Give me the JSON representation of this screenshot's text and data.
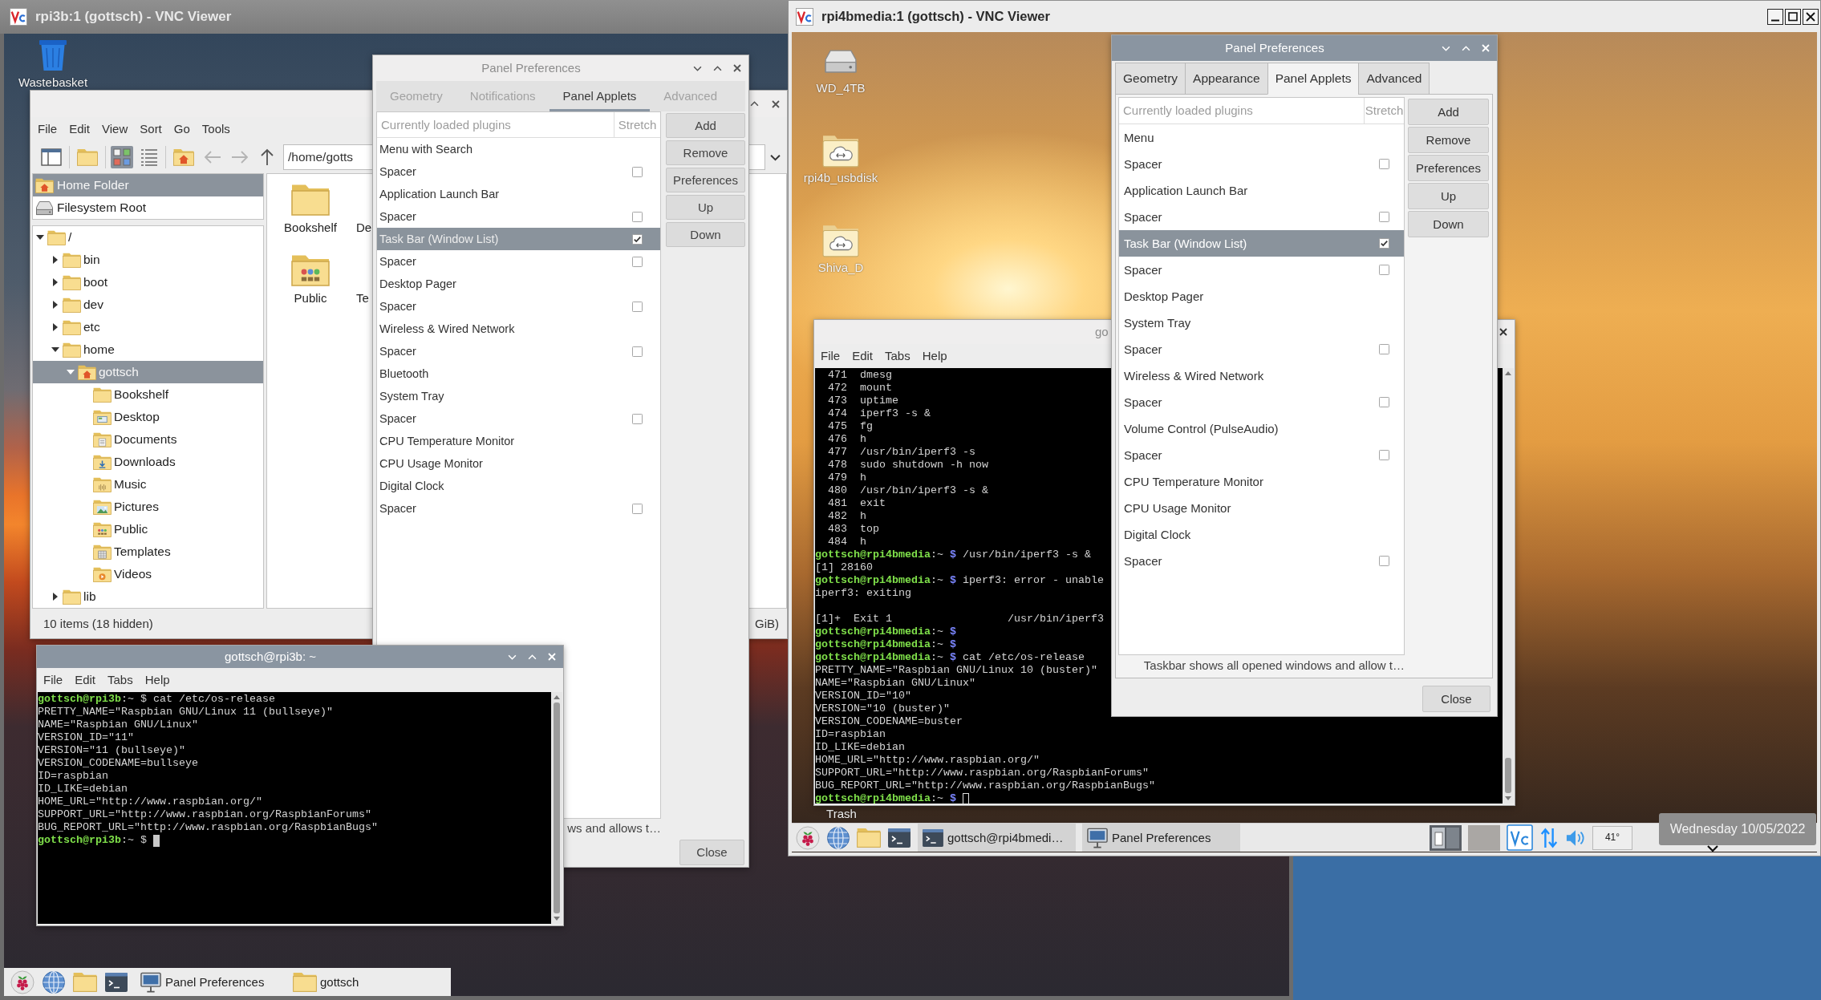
{
  "left_viewer": {
    "title": "rpi3b:1 (gottsch) - VNC Viewer",
    "active": false,
    "desktop_icons": [
      {
        "label": "Wastebasket",
        "kind": "trash"
      }
    ],
    "file_manager": {
      "active": false,
      "menu": [
        "File",
        "Edit",
        "View",
        "Sort",
        "Go",
        "Tools"
      ],
      "toolbar": [
        {
          "kind": "sidebar"
        },
        {
          "kind": "new_folder"
        },
        {
          "kind": "icon_view",
          "selected": true
        },
        {
          "kind": "list_view",
          "selected": false
        },
        {
          "kind": "home"
        },
        {
          "kind": "back",
          "disabled": true
        },
        {
          "kind": "forward",
          "disabled": true
        },
        {
          "kind": "up",
          "disabled": false
        }
      ],
      "path": "/home/gotts",
      "places": [
        {
          "label": "Home Folder",
          "kind": "home",
          "selected": true
        },
        {
          "label": "Filesystem Root",
          "kind": "drive",
          "selected": false
        }
      ],
      "tree": [
        {
          "label": "/",
          "kind": "folder",
          "expanded": true,
          "selected": false,
          "children": [
            {
              "label": "bin",
              "kind": "folder",
              "expanded": false,
              "selected": false
            },
            {
              "label": "boot",
              "kind": "folder",
              "expanded": false,
              "selected": false
            },
            {
              "label": "dev",
              "kind": "folder",
              "expanded": false,
              "selected": false
            },
            {
              "label": "etc",
              "kind": "folder",
              "expanded": false,
              "selected": false
            },
            {
              "label": "home",
              "kind": "folder",
              "expanded": true,
              "selected": false,
              "children": [
                {
                  "label": "gottsch",
                  "kind": "home",
                  "expanded": true,
                  "selected": true,
                  "children": [
                    {
                      "label": "Bookshelf",
                      "kind": "folder",
                      "selected": false
                    },
                    {
                      "label": "Desktop",
                      "kind": "desktop",
                      "selected": false
                    },
                    {
                      "label": "Documents",
                      "kind": "documents",
                      "selected": false
                    },
                    {
                      "label": "Downloads",
                      "kind": "downloads",
                      "selected": false
                    },
                    {
                      "label": "Music",
                      "kind": "music",
                      "selected": false
                    },
                    {
                      "label": "Pictures",
                      "kind": "pictures",
                      "selected": false
                    },
                    {
                      "label": "Public",
                      "kind": "public",
                      "selected": false
                    },
                    {
                      "label": "Templates",
                      "kind": "templates",
                      "selected": false
                    },
                    {
                      "label": "Videos",
                      "kind": "videos",
                      "selected": false
                    }
                  ]
                }
              ]
            },
            {
              "label": "lib",
              "kind": "folder",
              "expanded": false,
              "selected": false
            }
          ]
        }
      ],
      "items": [
        {
          "label": "Bookshelf",
          "kind": "folder"
        },
        {
          "label": "De"
        },
        {
          "label": "Public",
          "kind": "public"
        },
        {
          "label": "Te"
        }
      ],
      "status": "10 items (18 hidden)",
      "free_space": "GiB)"
    },
    "panel_preferences": {
      "title": "Panel Preferences",
      "active": false,
      "tabs": [
        {
          "label": "Geometry",
          "selected": false
        },
        {
          "label": "Notifications",
          "selected": false
        },
        {
          "label": "Panel Applets",
          "selected": true
        },
        {
          "label": "Advanced",
          "selected": false
        }
      ],
      "columns": [
        "Currently loaded plugins",
        "Stretch"
      ],
      "plugins": [
        {
          "label": "Menu with Search",
          "selected": false
        },
        {
          "label": "Spacer",
          "checked": false,
          "selected": false
        },
        {
          "label": "Application Launch Bar",
          "selected": false
        },
        {
          "label": "Spacer",
          "checked": false,
          "selected": false
        },
        {
          "label": "Task Bar (Window List)",
          "checked": true,
          "selected": true
        },
        {
          "label": "Spacer",
          "checked": false,
          "selected": false
        },
        {
          "label": "Desktop Pager",
          "selected": false
        },
        {
          "label": "Spacer",
          "checked": false,
          "selected": false
        },
        {
          "label": "Wireless & Wired Network",
          "selected": false
        },
        {
          "label": "Spacer",
          "checked": false,
          "selected": false
        },
        {
          "label": "Bluetooth",
          "selected": false
        },
        {
          "label": "System Tray",
          "selected": false
        },
        {
          "label": "Spacer",
          "checked": false,
          "selected": false
        },
        {
          "label": "CPU Temperature Monitor",
          "selected": false
        },
        {
          "label": "CPU Usage Monitor",
          "selected": false
        },
        {
          "label": "Digital Clock",
          "selected": false
        },
        {
          "label": "Spacer",
          "checked": false,
          "selected": false
        }
      ],
      "description": "ws and allows t…",
      "buttons": [
        "Add",
        "Remove",
        "Preferences",
        "Up",
        "Down"
      ],
      "close": "Close"
    },
    "terminal": {
      "title": "gottsch@rpi3b: ~",
      "active": true,
      "menu": [
        "File",
        "Edit",
        "Tabs",
        "Help"
      ],
      "lines": [
        {
          "kind": "prompt",
          "host": "gottsch@rpi3b",
          "path": ":~ $",
          "command": "cat /etc/os-release"
        },
        {
          "kind": "output",
          "text": "PRETTY_NAME=\"Raspbian GNU/Linux 11 (bullseye)\""
        },
        {
          "kind": "output",
          "text": "NAME=\"Raspbian GNU/Linux\""
        },
        {
          "kind": "output",
          "text": "VERSION_ID=\"11\""
        },
        {
          "kind": "output",
          "text": "VERSION=\"11 (bullseye)\""
        },
        {
          "kind": "output",
          "text": "VERSION_CODENAME=bullseye"
        },
        {
          "kind": "output",
          "text": "ID=raspbian"
        },
        {
          "kind": "output",
          "text": "ID_LIKE=debian"
        },
        {
          "kind": "output",
          "text": "HOME_URL=\"http://www.raspbian.org/\""
        },
        {
          "kind": "output",
          "text": "SUPPORT_URL=\"http://www.raspbian.org/RaspbianForums\""
        },
        {
          "kind": "output",
          "text": "BUG_REPORT_URL=\"http://www.raspbian.org/RaspbianBugs\""
        },
        {
          "kind": "prompt",
          "host": "gottsch@rpi3b",
          "path": ":~ $"
        }
      ]
    },
    "taskbar": {
      "launchers": [
        {
          "kind": "raspberry"
        },
        {
          "kind": "browser"
        },
        {
          "kind": "files"
        },
        {
          "kind": "terminal"
        }
      ],
      "windows": [
        {
          "label": "Panel Preferences",
          "kind": "settings"
        },
        {
          "label": "gottsch",
          "kind": "folder"
        }
      ]
    }
  },
  "right_viewer": {
    "title": "rpi4bmedia:1 (gottsch) - VNC Viewer",
    "active": true,
    "desktop_icons": [
      {
        "label": "WD_4TB",
        "kind": "drive"
      },
      {
        "label": "rpi4b_usbdisk",
        "kind": "network"
      },
      {
        "label": "Shiva_D",
        "kind": "network"
      }
    ],
    "trash_label": "Trash",
    "terminal": {
      "title": "go",
      "active": false,
      "menu": [
        "File",
        "Edit",
        "Tabs",
        "Help"
      ],
      "lines": [
        {
          "kind": "output",
          "text": "  471  dmesg"
        },
        {
          "kind": "output",
          "text": "  472  mount"
        },
        {
          "kind": "output",
          "text": "  473  uptime"
        },
        {
          "kind": "output",
          "text": "  474  iperf3 -s &"
        },
        {
          "kind": "output",
          "text": "  475  fg"
        },
        {
          "kind": "output",
          "text": "  476  h"
        },
        {
          "kind": "output",
          "text": "  477  /usr/bin/iperf3 -s"
        },
        {
          "kind": "output",
          "text": "  478  sudo shutdown -h now"
        },
        {
          "kind": "output",
          "text": "  479  h"
        },
        {
          "kind": "output",
          "text": "  480  /usr/bin/iperf3 -s &"
        },
        {
          "kind": "output",
          "text": "  481  exit"
        },
        {
          "kind": "output",
          "text": "  482  h"
        },
        {
          "kind": "output",
          "text": "  483  top"
        },
        {
          "kind": "output",
          "text": "  484  h"
        },
        {
          "kind": "prompt",
          "host": "gottsch@rpi4bmedia",
          "path": ":~",
          "sigil": "$",
          "command": "/usr/bin/iperf3 -s &"
        },
        {
          "kind": "output",
          "text": "[1] 28160"
        },
        {
          "kind": "prompt",
          "host": "gottsch@rpi4bmedia",
          "path": ":~",
          "sigil": "$",
          "command": "iperf3: error - unable"
        },
        {
          "kind": "output",
          "text": "iperf3: exiting"
        },
        {
          "kind": "blank"
        },
        {
          "kind": "output",
          "text": "[1]+  Exit 1                  /usr/bin/iperf3"
        },
        {
          "kind": "prompt",
          "host": "gottsch@rpi4bmedia",
          "path": ":~",
          "sigil": "$"
        },
        {
          "kind": "prompt",
          "host": "gottsch@rpi4bmedia",
          "path": ":~",
          "sigil": "$"
        },
        {
          "kind": "prompt",
          "host": "gottsch@rpi4bmedia",
          "path": ":~",
          "sigil": "$",
          "command": "cat /etc/os-release"
        },
        {
          "kind": "output",
          "text": "PRETTY_NAME=\"Raspbian GNU/Linux 10 (buster)\""
        },
        {
          "kind": "output",
          "text": "NAME=\"Raspbian GNU/Linux\""
        },
        {
          "kind": "output",
          "text": "VERSION_ID=\"10\""
        },
        {
          "kind": "output",
          "text": "VERSION=\"10 (buster)\""
        },
        {
          "kind": "output",
          "text": "VERSION_CODENAME=buster"
        },
        {
          "kind": "output",
          "text": "ID=raspbian"
        },
        {
          "kind": "output",
          "text": "ID_LIKE=debian"
        },
        {
          "kind": "output",
          "text": "HOME_URL=\"http://www.raspbian.org/\""
        },
        {
          "kind": "output",
          "text": "SUPPORT_URL=\"http://www.raspbian.org/RaspbianForums\""
        },
        {
          "kind": "output",
          "text": "BUG_REPORT_URL=\"http://www.raspbian.org/RaspbianBugs\""
        },
        {
          "kind": "prompt",
          "host": "gottsch@rpi4bmedia",
          "path": ":~",
          "sigil": "$"
        }
      ]
    },
    "panel_preferences": {
      "title": "Panel Preferences",
      "active": true,
      "tabs": [
        {
          "label": "Geometry",
          "selected": false
        },
        {
          "label": "Appearance",
          "selected": false
        },
        {
          "label": "Panel Applets",
          "selected": true
        },
        {
          "label": "Advanced",
          "selected": false
        }
      ],
      "columns": [
        "Currently loaded plugins",
        "Stretch"
      ],
      "plugins": [
        {
          "label": "Menu",
          "selected": false
        },
        {
          "label": "Spacer",
          "checked": false,
          "selected": false
        },
        {
          "label": "Application Launch Bar",
          "selected": false
        },
        {
          "label": "Spacer",
          "checked": false,
          "selected": false
        },
        {
          "label": "Task Bar (Window List)",
          "checked": true,
          "selected": true
        },
        {
          "label": "Spacer",
          "checked": false,
          "selected": false
        },
        {
          "label": "Desktop Pager",
          "selected": false
        },
        {
          "label": "System Tray",
          "selected": false
        },
        {
          "label": "Spacer",
          "checked": false,
          "selected": false
        },
        {
          "label": "Wireless & Wired Network",
          "selected": false
        },
        {
          "label": "Spacer",
          "checked": false,
          "selected": false
        },
        {
          "label": "Volume Control (PulseAudio)",
          "selected": false
        },
        {
          "label": "Spacer",
          "checked": false,
          "selected": false
        },
        {
          "label": "CPU Temperature Monitor",
          "selected": false
        },
        {
          "label": "CPU Usage Monitor",
          "selected": false
        },
        {
          "label": "Digital Clock",
          "selected": false
        },
        {
          "label": "Spacer",
          "checked": false,
          "selected": false
        }
      ],
      "description": "Taskbar shows all opened windows and allow t…",
      "buttons": [
        "Add",
        "Remove",
        "Preferences",
        "Up",
        "Down"
      ],
      "close": "Close"
    },
    "taskbar": {
      "launchers": [
        {
          "kind": "raspberry"
        },
        {
          "kind": "browser"
        },
        {
          "kind": "files"
        },
        {
          "kind": "terminal"
        }
      ],
      "windows": [
        {
          "label": "gottsch@rpi4bmedi…",
          "kind": "terminal"
        },
        {
          "label": "Panel Preferences",
          "kind": "settings"
        }
      ],
      "tray": [
        {
          "kind": "pager"
        },
        {
          "kind": "cpu_meter"
        },
        {
          "kind": "vnc"
        },
        {
          "kind": "network"
        },
        {
          "kind": "volume"
        },
        {
          "kind": "temperature",
          "text": "41°"
        }
      ],
      "tooltip": "Wednesday 10/05/2022"
    }
  }
}
